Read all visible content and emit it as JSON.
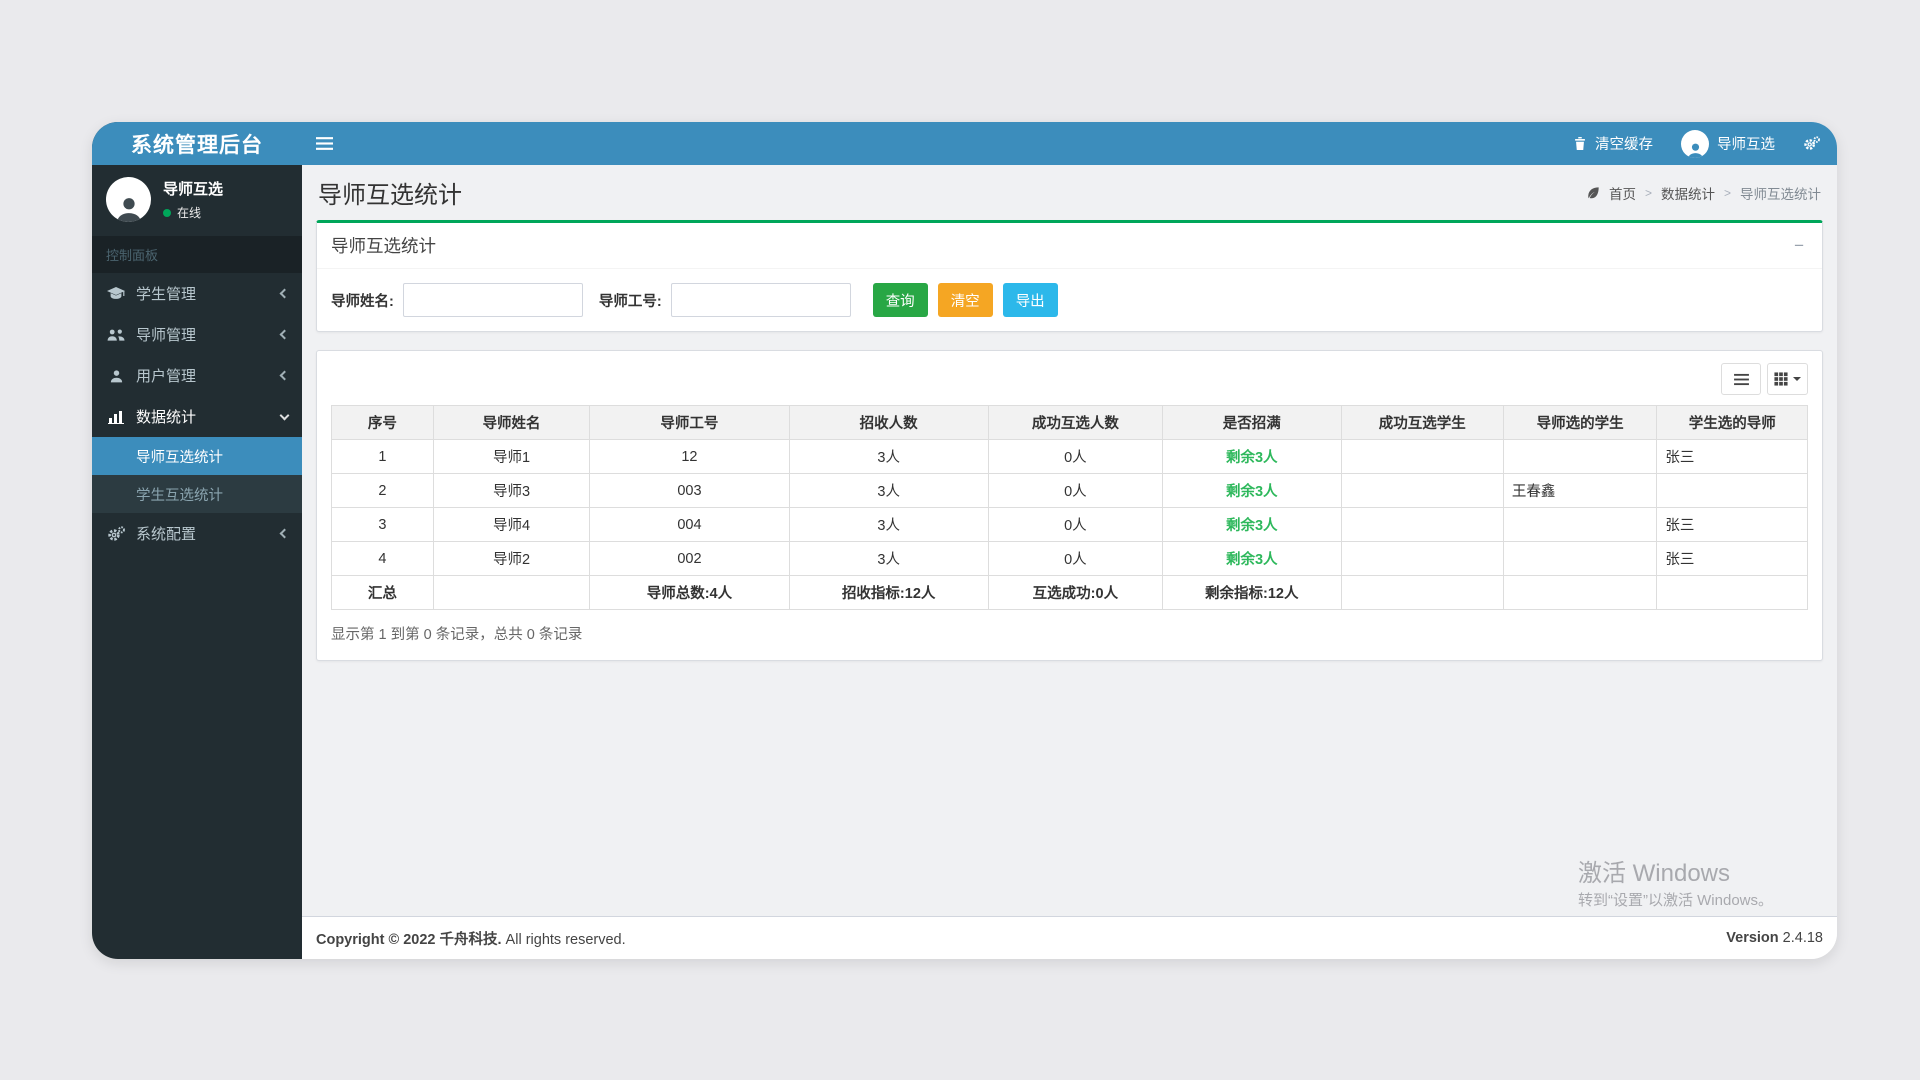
{
  "app": {
    "logo_title": "系统管理后台"
  },
  "navbar": {
    "clear_cache_label": "清空缓存",
    "user_label": "导师互选"
  },
  "sidebar": {
    "user_name": "导师互选",
    "user_status": "在线",
    "section_header": "控制面板",
    "items": [
      {
        "label": "学生管理",
        "icon": "graduation-cap-icon"
      },
      {
        "label": "导师管理",
        "icon": "users-icon"
      },
      {
        "label": "用户管理",
        "icon": "user-icon"
      },
      {
        "label": "数据统计",
        "icon": "bar-chart-icon",
        "expanded": true,
        "children": [
          {
            "label": "导师互选统计",
            "active": true
          },
          {
            "label": "学生互选统计",
            "active": false
          }
        ]
      },
      {
        "label": "系统配置",
        "icon": "cogs-icon"
      }
    ]
  },
  "page_header": {
    "title": "导师互选统计",
    "breadcrumb": [
      {
        "label": "首页"
      },
      {
        "label": "数据统计"
      },
      {
        "label": "导师互选统计"
      }
    ],
    "breadcrumb_separator": ">"
  },
  "filter_panel": {
    "title": "导师互选统计",
    "minimize_icon_glyph": "−",
    "fields": [
      {
        "label": "导师姓名:",
        "value": ""
      },
      {
        "label": "导师工号:",
        "value": ""
      }
    ],
    "buttons": [
      {
        "label": "查询",
        "color": "#28a745"
      },
      {
        "label": "清空",
        "color": "#f5a623"
      },
      {
        "label": "导出",
        "color": "#2cb8ea"
      }
    ]
  },
  "table": {
    "headers": [
      "序号",
      "导师姓名",
      "导师工号",
      "招收人数",
      "成功互选人数",
      "是否招满",
      "成功互选学生",
      "导师选的学生",
      "学生选的导师"
    ],
    "rows": [
      [
        "1",
        "导师1",
        "12",
        "3人",
        "0人",
        "剩余3人",
        "",
        "",
        "张三"
      ],
      [
        "2",
        "导师3",
        "003",
        "3人",
        "0人",
        "剩余3人",
        "",
        "王春鑫",
        ""
      ],
      [
        "3",
        "导师4",
        "004",
        "3人",
        "0人",
        "剩余3人",
        "",
        "",
        "张三"
      ],
      [
        "4",
        "导师2",
        "002",
        "3人",
        "0人",
        "剩余3人",
        "",
        "",
        "张三"
      ]
    ],
    "summary_row": [
      "汇总",
      "",
      "导师总数:4人",
      "招收指标:12人",
      "互选成功:0人",
      "剩余指标:12人",
      "",
      "",
      ""
    ],
    "record_info": "显示第 1 到第 0 条记录，总共 0 条记录"
  },
  "watermark": {
    "line1": "激活 Windows",
    "line2": "转到“设置”以激活 Windows。"
  },
  "footer": {
    "copyright_bold": "Copyright © 2022 千舟科技.",
    "copyright_rest": " All rights reserved.",
    "version_label": "Version",
    "version_value": " 2.4.18"
  },
  "colors": {
    "navbar_blue": "#3c8dbc",
    "sidebar_dark": "#222d32",
    "submenu_dark": "#2c3b41",
    "success_green": "#00a65a",
    "remaining_text_green": "#2eb85c",
    "query_button": "#28a745",
    "clear_button": "#f5a623",
    "export_button": "#2cb8ea"
  }
}
